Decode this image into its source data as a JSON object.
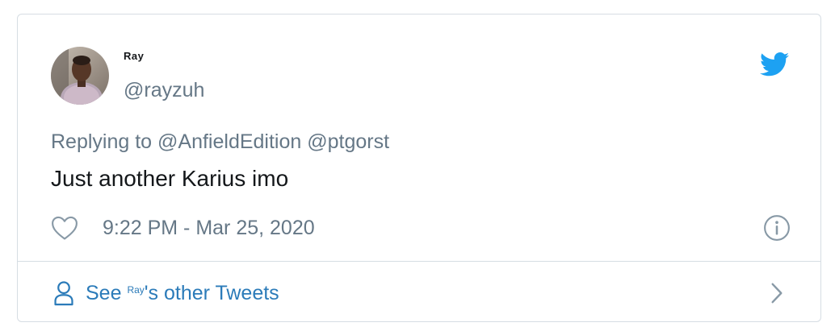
{
  "tweet": {
    "display_name": "Ray",
    "handle": "@rayzuh",
    "replying_prefix": "Replying to",
    "mention_1": "@AnfieldEdition",
    "mention_2": "@ptgorst",
    "text": "Just another Karius imo",
    "timestamp": "9:22 PM - Mar 25, 2020"
  },
  "footer": {
    "see_label": "See",
    "name_superscript": "Ray",
    "suffix": "'s other Tweets"
  },
  "icons": {
    "brand": "twitter-bird-icon",
    "like": "heart-icon",
    "info": "info-icon",
    "profile": "person-icon",
    "next": "chevron-right-icon"
  },
  "colors": {
    "twitter_blue": "#1da1f2",
    "link_blue": "#2b7bb9",
    "secondary_text": "#657786",
    "primary_text": "#14171a",
    "border": "#d6dde3"
  }
}
